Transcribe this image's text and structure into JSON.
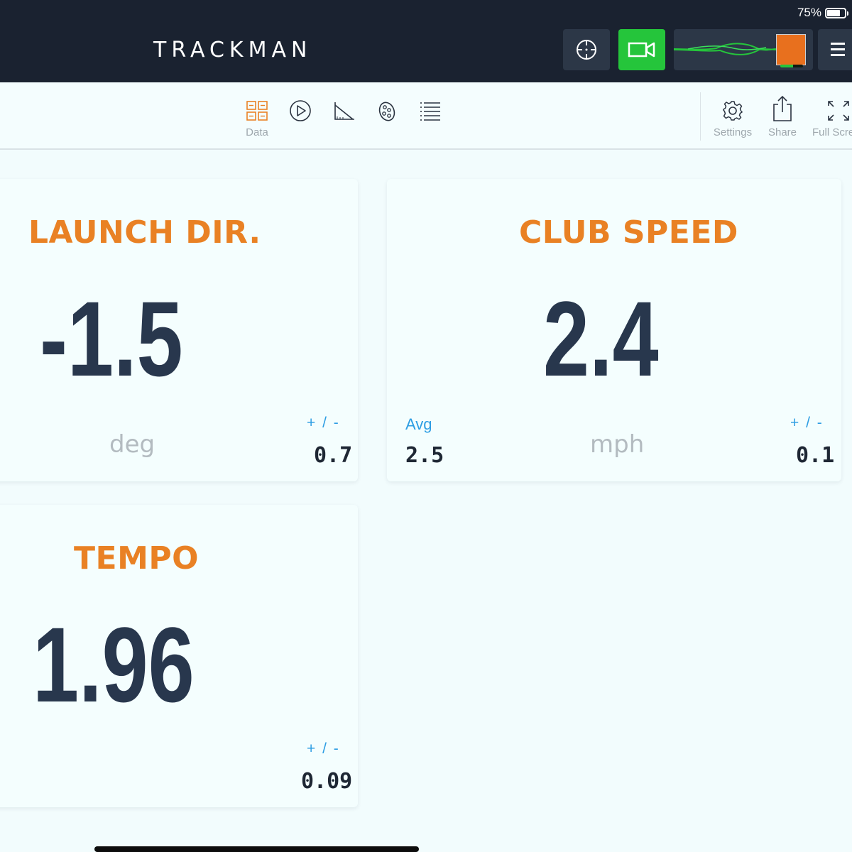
{
  "status_bar": {
    "battery_percent": "75%",
    "battery_level": 0.75
  },
  "header": {
    "logo": "TRACKMAN",
    "buttons": [
      {
        "name": "target",
        "icon": "crosshair-icon",
        "color": "#2c3747"
      },
      {
        "name": "video",
        "icon": "video-camera-icon",
        "color": "#25c53b"
      },
      {
        "name": "replay-preview",
        "icon": "trajectory-preview-icon"
      },
      {
        "name": "menu",
        "icon": "hamburger-menu-icon"
      }
    ]
  },
  "toolbar": {
    "left_tools": [
      {
        "icon": "data-grid-icon",
        "label": "Data",
        "active": true
      },
      {
        "icon": "play-icon",
        "label": ""
      },
      {
        "icon": "angle-ruler-icon",
        "label": ""
      },
      {
        "icon": "ball-dispersion-icon",
        "label": ""
      },
      {
        "icon": "list-icon",
        "label": ""
      }
    ],
    "right_tools": [
      {
        "icon": "gear-icon",
        "label": "Settings"
      },
      {
        "icon": "share-icon",
        "label": "Share"
      },
      {
        "icon": "fullscreen-icon",
        "label": "Full Scre"
      }
    ]
  },
  "metrics": {
    "launch_dir": {
      "title": "LAUNCH DIR.",
      "value": "-1.5",
      "unit": "deg",
      "pm_label": "+ / -",
      "pm_value": "0.7"
    },
    "club_speed": {
      "title": "CLUB SPEED",
      "value": "2.4",
      "unit": "mph",
      "avg_label": "Avg",
      "avg_value": "2.5",
      "pm_label": "+ / -",
      "pm_value": "0.1"
    },
    "tempo": {
      "title": "TEMPO",
      "value": "1.96",
      "pm_label": "+ / -",
      "pm_value": "0.09"
    }
  },
  "colors": {
    "accent": "#e98124",
    "value_text": "#28374d",
    "header_bg": "#1a2230",
    "stat_blue": "#2e9ee3"
  }
}
